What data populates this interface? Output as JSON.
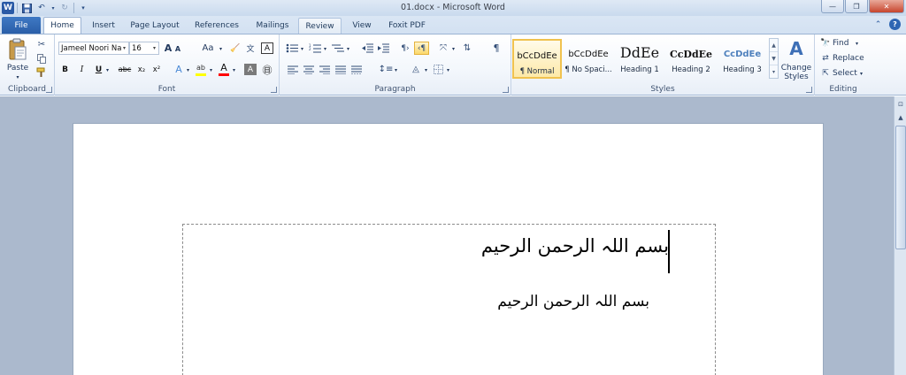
{
  "window": {
    "title": "01.docx - Microsoft Word",
    "app_logo": "W",
    "controls": [
      "—",
      "❐",
      "✕"
    ]
  },
  "quick_access": {
    "save_icon": "save-icon",
    "undo_icon": "undo-icon",
    "redo_icon": "redo-icon",
    "customize_icon": "customize-icon"
  },
  "tabs": [
    "File",
    "Home",
    "Insert",
    "Page Layout",
    "References",
    "Mailings",
    "Review",
    "View",
    "Foxit PDF"
  ],
  "active_tab": "Home",
  "clipboard": {
    "label": "Clipboard",
    "paste": "Paste"
  },
  "font": {
    "label": "Font",
    "name": "Jameel Noori Na",
    "size": "16",
    "bold": "B",
    "italic": "I",
    "underline": "U",
    "strike": "abc",
    "subscript": "x₂",
    "superscript": "x²",
    "grow": "A",
    "shrink": "A",
    "case": "Aa",
    "font_color_letter": "A",
    "highlight_color": "#ffff00",
    "font_color": "#ff0000"
  },
  "paragraph": {
    "label": "Paragraph",
    "pilcrow": "¶"
  },
  "styles": {
    "label": "Styles",
    "items": [
      {
        "sample": "bCcDdEe",
        "name": "¶ Normal"
      },
      {
        "sample": "bCcDdEe",
        "name": "¶ No Spaci..."
      },
      {
        "sample": "DdEe",
        "name": "Heading 1"
      },
      {
        "sample": "CcDdEe",
        "name": "Heading 2"
      },
      {
        "sample": "CcDdEe",
        "name": "Heading 3"
      }
    ],
    "change_styles": "Change Styles"
  },
  "editing": {
    "label": "Editing",
    "find": "Find",
    "replace": "Replace",
    "select": "Select"
  },
  "document": {
    "line1": "بسم اللہ الرحمن الرحیم",
    "line2": "بسم اللہ الرحمن الرحیم"
  },
  "colors": {
    "file_tab": "#2a5ea8",
    "doc_background": "#abb9cd",
    "selected_style_border": "#f0c24f"
  }
}
